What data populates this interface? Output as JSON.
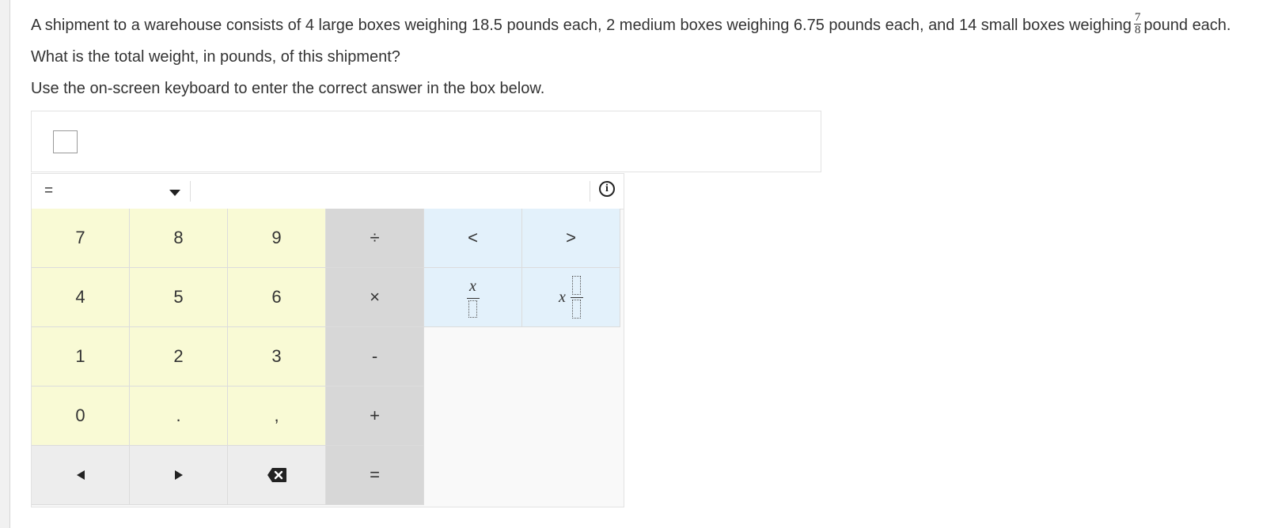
{
  "question": {
    "line1_before": "A shipment to a warehouse consists of 4 large boxes weighing 18.5 pounds each, 2 medium boxes weighing 6.75 pounds each, and 14 small boxes weighing",
    "frac_num": "7",
    "frac_den": "8",
    "line1_after": "pound each.",
    "line2": "What is the total weight, in pounds, of this shipment?",
    "line3": "Use the on-screen keyboard to enter the correct answer in the box below."
  },
  "answer": {
    "value": ""
  },
  "toolbar": {
    "selected_symbol": "=",
    "info_glyph": "i"
  },
  "keys": {
    "seven": "7",
    "eight": "8",
    "nine": "9",
    "divide": "÷",
    "less_than": "<",
    "greater_than": ">",
    "four": "4",
    "five": "5",
    "six": "6",
    "multiply": "×",
    "one": "1",
    "two": "2",
    "three": "3",
    "minus": "-",
    "zero": "0",
    "decimal": ".",
    "comma": ",",
    "plus": "+",
    "equals": "=",
    "fraction_var": "x",
    "mixed_var": "x"
  },
  "colors": {
    "digit_bg": "#f9fad5",
    "operator_bg": "#d7d7d7",
    "relation_bg": "#e3f1fb",
    "nav_bg": "#ededed"
  },
  "icons": {
    "left": "left-arrow-icon",
    "right": "right-arrow-icon",
    "backspace": "backspace-icon",
    "info": "info-icon",
    "dropdown": "caret-down-icon"
  }
}
